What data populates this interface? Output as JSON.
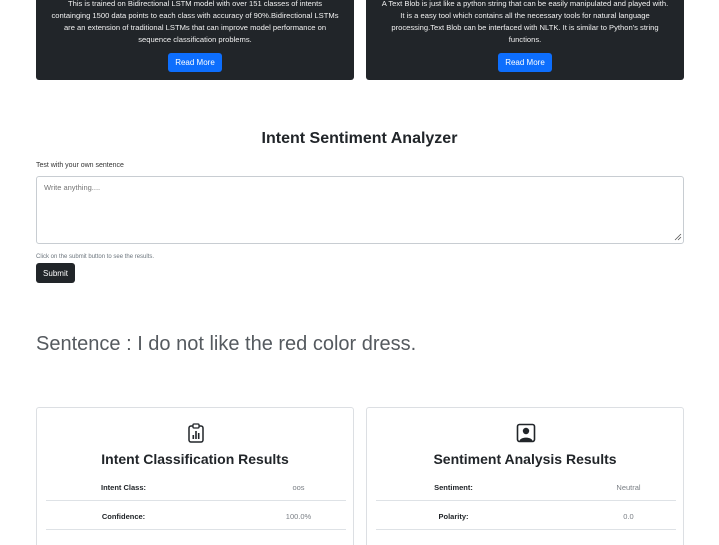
{
  "info_cards": {
    "left": {
      "text": "This is trained on Bidirectional LSTM model with over 151 classes of intents containging 1500 data points to each class with accuracy of 90%.Bidirectional LSTMs are an extension of traditional LSTMs that can improve model performance on sequence classification problems.",
      "button_label": "Read More"
    },
    "right": {
      "text": "A Text Blob is just like a python string that can be easily manipulated and played with. It is a easy tool which contains all the necessary tools for natural language processing.Text Blob can be interfaced with NLTK. It is similar to Python's string functions.",
      "button_label": "Read More"
    }
  },
  "analyzer": {
    "title": "Intent Sentiment Analyzer",
    "input_label": "Test with your own sentence",
    "placeholder": "Write anything....",
    "hint": "Click on the submit button to see the results.",
    "submit_label": "Submit"
  },
  "sentence": {
    "prefix": "Sentence : ",
    "value": "I do not like the red color dress."
  },
  "intent_results": {
    "icon": "clipboard-data-icon",
    "title": "Intent Classification Results",
    "rows": [
      {
        "label": "Intent Class:",
        "value": "oos"
      },
      {
        "label": "Confidence:",
        "value": "100.0%"
      }
    ]
  },
  "sentiment_results": {
    "icon": "person-square-icon",
    "title": "Sentiment Analysis Results",
    "rows": [
      {
        "label": "Sentiment:",
        "value": "Neutral"
      },
      {
        "label": "Polarity:",
        "value": "0.0"
      }
    ]
  }
}
